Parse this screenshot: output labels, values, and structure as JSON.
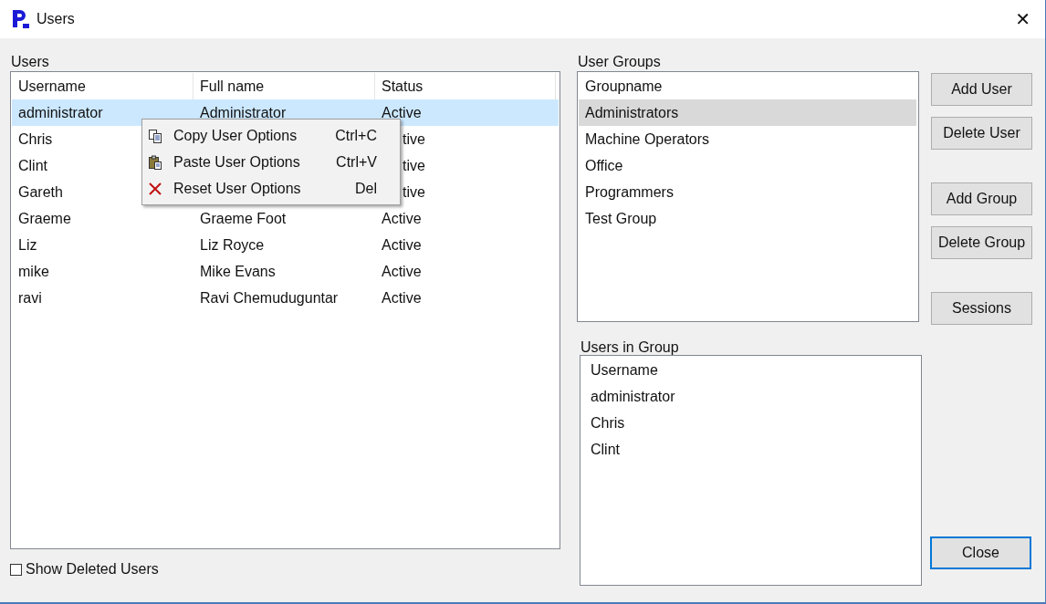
{
  "window": {
    "title": "Users",
    "close": "✕"
  },
  "users": {
    "label": "Users",
    "columns": [
      "Username",
      "Full name",
      "Status"
    ],
    "rows": [
      {
        "username": "administrator",
        "full_name": "Administrator",
        "status": "Active",
        "selected": true
      },
      {
        "username": "Chris",
        "status": "tive",
        "selected": false
      },
      {
        "username": "Clint",
        "status": "tive",
        "selected": false
      },
      {
        "username": "Gareth",
        "status": "tive",
        "selected": false
      },
      {
        "username": "Graeme",
        "full_name": "Graeme Foot",
        "status": "Active",
        "selected": false
      },
      {
        "username": "Liz",
        "full_name": "Liz Royce",
        "status": "Active",
        "selected": false
      },
      {
        "username": "mike",
        "full_name": "Mike Evans",
        "status": "Active",
        "selected": false
      },
      {
        "username": "ravi",
        "full_name": "Ravi Chemuduguntar",
        "status": "Active",
        "selected": false
      }
    ]
  },
  "context_menu": [
    {
      "kind": "copy",
      "label": "Copy User Options",
      "shortcut": "Ctrl+C"
    },
    {
      "kind": "paste",
      "label": "Paste User Options",
      "shortcut": "Ctrl+V"
    },
    {
      "kind": "reset",
      "label": "Reset User Options",
      "shortcut": "Del"
    }
  ],
  "show_deleted": {
    "label": "Show Deleted Users",
    "checked": false
  },
  "user_groups": {
    "label": "User Groups",
    "column": "Groupname",
    "rows": [
      {
        "name": "Administrators",
        "selected": true
      },
      {
        "name": "Machine Operators",
        "selected": false
      },
      {
        "name": "Office",
        "selected": false
      },
      {
        "name": "Programmers",
        "selected": false
      },
      {
        "name": "Test Group",
        "selected": false
      }
    ]
  },
  "users_in_group": {
    "label": "Users in Group",
    "column": "Username",
    "rows": [
      "administrator",
      "Chris",
      "Clint"
    ]
  },
  "button_groups": [
    [
      "Add User",
      "Delete User"
    ],
    [
      "Add Group",
      "Delete Group"
    ],
    [
      "Sessions"
    ]
  ],
  "close_button": "Close"
}
